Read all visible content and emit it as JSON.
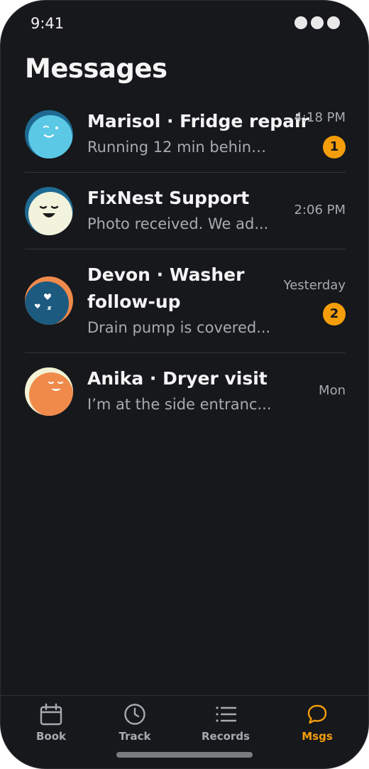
{
  "status_bar": {
    "time": "9:41"
  },
  "page": {
    "title": "Messages"
  },
  "conversations": [
    {
      "name": "Marisol · Fridge repair",
      "preview": "Running 12 min behind....",
      "time": "4:18 PM",
      "unread": "1"
    },
    {
      "name": "FixNest Support",
      "preview": "Photo received. We ad...",
      "time": "2:06 PM",
      "unread": ""
    },
    {
      "name": "Devon · Washer",
      "name_line2": "follow-up",
      "preview": "Drain pump is covered...",
      "time": "Yesterday",
      "unread": "2"
    },
    {
      "name": "Anika · Dryer visit",
      "preview": "I’m at the side entranc...",
      "time": "Mon",
      "unread": ""
    }
  ],
  "tabbar": {
    "tabs": [
      {
        "label": "Book",
        "icon": "calendar-icon"
      },
      {
        "label": "Track",
        "icon": "clock-icon"
      },
      {
        "label": "Records",
        "icon": "list-icon"
      },
      {
        "label": "Msgs",
        "icon": "chat-bubble-icon"
      }
    ],
    "active": "Msgs"
  },
  "colors": {
    "background": "#17181b",
    "accent": "#f59e0b",
    "text": "#f4f4f5",
    "muted": "#a9aab0",
    "divider": "#34353a"
  }
}
